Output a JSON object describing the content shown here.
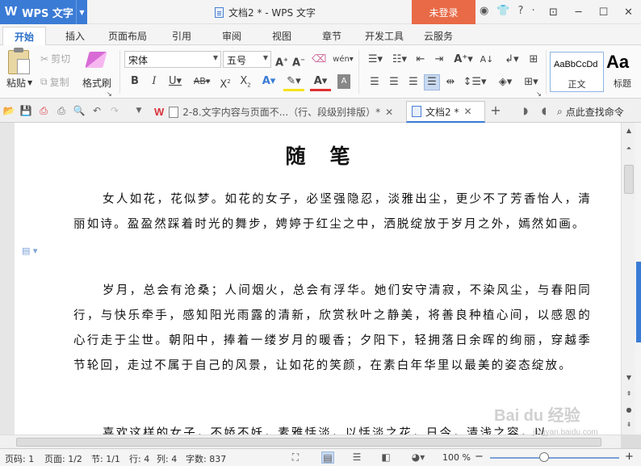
{
  "app": {
    "logo": "W",
    "name": "WPS 文字",
    "window_title": "文档2 * - WPS 文字",
    "login_label": "未登录"
  },
  "title_icons": [
    "◉",
    "👕",
    "?",
    "·"
  ],
  "window_controls": [
    "⊡",
    "─",
    "☐",
    "✕"
  ],
  "menu": {
    "tabs": [
      "开始",
      "插入",
      "页面布局",
      "引用",
      "审阅",
      "视图",
      "章节",
      "开发工具",
      "云服务"
    ]
  },
  "ribbon": {
    "paste": "粘贴",
    "cut": "剪切",
    "copy": "复制",
    "format_painter": "格式刷",
    "font_name": "宋体",
    "font_size": "五号",
    "style_normal_preview": "AaBbCcDd",
    "style_normal": "正文",
    "style_heading_preview": "Aa",
    "style_heading": "标题"
  },
  "doc_tabs": [
    {
      "label": "2-8.文字内容与页面不...（行、段级别排版）*"
    },
    {
      "label": "文档2 *"
    }
  ],
  "search_cmd": "点此查找命令",
  "document": {
    "title": "随笔",
    "paragraphs": [
      "女人如花，花似梦。如花的女子，必坚强隐忍，淡雅出尘，更少不了芳香怡人，清丽如诗。盈盈然踩着时光的舞步，娉婷于红尘之中，洒脱绽放于岁月之外，嫣然如画。",
      "岁月，总会有沧桑；人间烟火，总会有浮华。她们安守清寂，不染风尘，与春阳同行，与快乐牵手，感知阳光雨露的清新，欣赏秋叶之静美，将善良种植心间，以感恩的心行走于尘世。朝阳中，捧着一缕岁月的暖香；夕阳下，轻拥落日余晖的绚丽，穿越季节轮回，走过不属于自己的风景，让如花的笑颜，在素白年华里以最美的姿态绽放。",
      "喜欢这样的女子，不娇不妖，素雅恬淡，以恬淡之花，日今，清浅之容，以"
    ]
  },
  "status": {
    "page_code": "页码: 1",
    "page": "页面: 1/2",
    "section": "节: 1/1",
    "row": "行: 4",
    "col": "列: 4",
    "word_count": "字数: 837",
    "zoom": "100 %",
    "zoom_minus": "−",
    "zoom_plus": "+"
  },
  "watermark": {
    "brand": "Bai du 经验",
    "url": "jingyan.baidu.com"
  },
  "colors": {
    "accent": "#3a7bd5",
    "login": "#e86a46",
    "active_tab_text": "#2b6fc8"
  }
}
